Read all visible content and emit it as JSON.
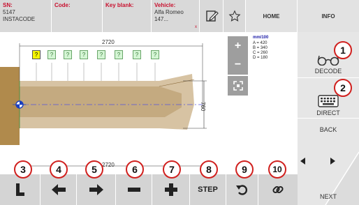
{
  "header": {
    "sn_label": "SN:",
    "sn_line1": "5147",
    "sn_line2": "INSTACODE",
    "code_label": "Code:",
    "key_blank_label": "Key blank:",
    "vehicle_label": "Vehicle:",
    "vehicle_line1": "Alfa Romeo",
    "vehicle_line2": "147...",
    "home_label": "HOME",
    "info_label": "INFO",
    "edit_icon": "edit-icon",
    "favorite_icon": "star-icon"
  },
  "drawing": {
    "dim_top": "2720",
    "dim_bottom": "2720",
    "dim_right": "760",
    "cut_markers": [
      "?",
      "?",
      "?",
      "?",
      "?",
      "?",
      "?",
      "?"
    ],
    "active_marker_color": "#f5f500",
    "marker_color": "#d4f5d4",
    "blade_color": "#d7c3a3",
    "head_color": "#b08a4c"
  },
  "zoom": {
    "zoom_in": "+",
    "zoom_out": "−",
    "fit_icon": "fit-screen-icon"
  },
  "dimensions": {
    "unit": "mm/100",
    "rows": [
      "A = 420",
      "B = 340",
      "C = 260",
      "D = 180"
    ]
  },
  "side_menu": {
    "decode_label": "DECODE",
    "decode_icon": "glasses-icon",
    "direct_label": "DIRECT",
    "direct_icon": "keyboard-icon",
    "back_label": "BACK",
    "next_label": "NEXT"
  },
  "toolbar": {
    "step_label": "STEP",
    "buttons": [
      "shoulder-icon",
      "arrow-left-icon",
      "arrow-right-icon",
      "minus-icon",
      "plus-icon",
      "step-button",
      "undo-icon",
      "cut-icon"
    ]
  },
  "callouts": [
    "1",
    "2",
    "3",
    "4",
    "5",
    "6",
    "7",
    "8",
    "9",
    "10"
  ]
}
